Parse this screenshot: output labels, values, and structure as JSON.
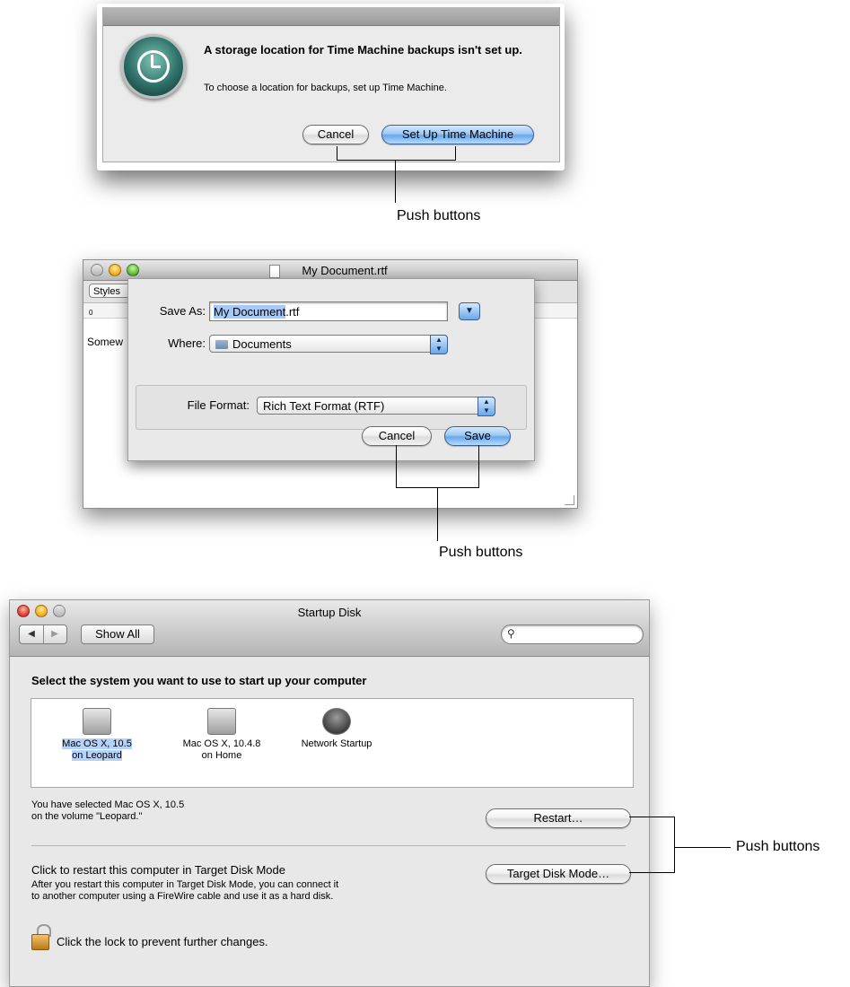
{
  "dialog_time_machine": {
    "heading": "A storage location for Time Machine backups isn't set up.",
    "message": "To choose a location for backups, set up Time Machine.",
    "cancel_label": "Cancel",
    "primary_label": "Set Up Time Machine"
  },
  "save_sheet": {
    "window_title": "My Document.rtf",
    "toolbar_styles": "Styles",
    "ruler_zero": "0",
    "body_text": "Somew",
    "save_as_label": "Save As:",
    "save_as_selected": "My Document",
    "save_as_ext": ".rtf",
    "where_label": "Where:",
    "where_value": "Documents",
    "file_format_label": "File Format:",
    "file_format_value": "Rich Text Format (RTF)",
    "cancel_label": "Cancel",
    "save_label": "Save"
  },
  "startup_disk": {
    "window_title": "Startup Disk",
    "show_all_label": "Show All",
    "search_placeholder": "",
    "heading": "Select the system you want to use to start up your computer",
    "disks": [
      {
        "line1": "Mac OS X, 10.5",
        "line2": "on Leopard"
      },
      {
        "line1": "Mac OS X, 10.4.8",
        "line2": "on Home"
      },
      {
        "line1": "Network Startup",
        "line2": ""
      }
    ],
    "selected_info_line1": "You have selected Mac OS X, 10.5",
    "selected_info_line2": "on the volume \"Leopard.\"",
    "restart_label": "Restart…",
    "tdm_heading": "Click to restart this computer in Target Disk Mode",
    "tdm_desc_line1": "After you restart this computer in Target Disk Mode, you can connect it",
    "tdm_desc_line2": "to another computer using a FireWire cable and use it as a hard disk.",
    "tdm_button_label": "Target Disk Mode…",
    "lock_text": "Click the lock to prevent further changes."
  },
  "callouts": {
    "callout1": "Push buttons",
    "callout2": "Push buttons",
    "callout3": "Push buttons"
  },
  "colors": {
    "default_button": "#6aa7ea",
    "selection": "#a8c8f5",
    "window_bg": "#e8e8e8"
  }
}
